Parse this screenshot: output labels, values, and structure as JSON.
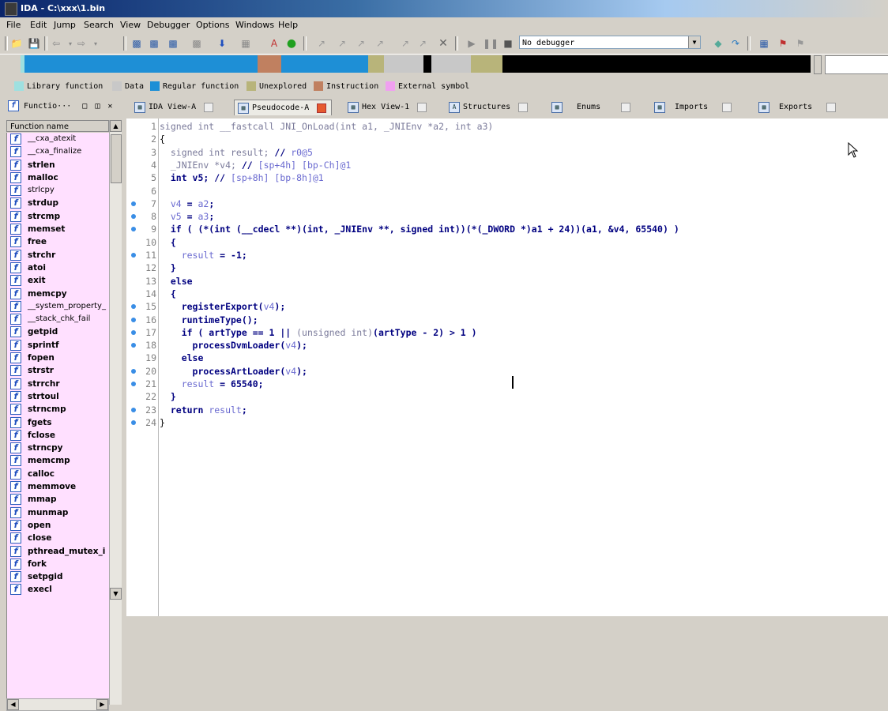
{
  "window": {
    "title": "IDA - C:\\xxx\\1.bin"
  },
  "menu": [
    "File",
    "Edit",
    "Jump",
    "Search",
    "View",
    "Debugger",
    "Options",
    "Windows",
    "Help"
  ],
  "toolbar": {
    "debugger_select": "No debugger"
  },
  "legend": [
    {
      "label": "Library function",
      "color": "#9ee0e0"
    },
    {
      "label": "Data",
      "color": "#c8c8c8"
    },
    {
      "label": "Regular function",
      "color": "#1e8fd6"
    },
    {
      "label": "Unexplored",
      "color": "#b8b47a"
    },
    {
      "label": "Instruction",
      "color": "#c08060"
    },
    {
      "label": "External symbol",
      "color": "#f0a0f0"
    }
  ],
  "functions_pane": {
    "tab_label": "Functio···",
    "header": "Function name",
    "items": [
      {
        "name": "__cxa_atexit",
        "bold": false
      },
      {
        "name": "__cxa_finalize",
        "bold": false
      },
      {
        "name": "strlen",
        "bold": true
      },
      {
        "name": "malloc",
        "bold": true
      },
      {
        "name": "strlcpy",
        "bold": false
      },
      {
        "name": "strdup",
        "bold": true
      },
      {
        "name": "strcmp",
        "bold": true
      },
      {
        "name": "memset",
        "bold": true
      },
      {
        "name": "free",
        "bold": true
      },
      {
        "name": "strchr",
        "bold": true
      },
      {
        "name": "atoi",
        "bold": true
      },
      {
        "name": "exit",
        "bold": true
      },
      {
        "name": "memcpy",
        "bold": true
      },
      {
        "name": "__system_property_",
        "bold": false
      },
      {
        "name": "__stack_chk_fail",
        "bold": false
      },
      {
        "name": "getpid",
        "bold": true
      },
      {
        "name": "sprintf",
        "bold": true
      },
      {
        "name": "fopen",
        "bold": true
      },
      {
        "name": "strstr",
        "bold": true
      },
      {
        "name": "strrchr",
        "bold": true
      },
      {
        "name": "strtoul",
        "bold": true
      },
      {
        "name": "strncmp",
        "bold": true
      },
      {
        "name": "fgets",
        "bold": true
      },
      {
        "name": "fclose",
        "bold": true
      },
      {
        "name": "strncpy",
        "bold": true
      },
      {
        "name": "memcmp",
        "bold": true
      },
      {
        "name": "calloc",
        "bold": true
      },
      {
        "name": "memmove",
        "bold": true
      },
      {
        "name": "mmap",
        "bold": true
      },
      {
        "name": "munmap",
        "bold": true
      },
      {
        "name": "open",
        "bold": true
      },
      {
        "name": "close",
        "bold": true
      },
      {
        "name": "pthread_mutex_i",
        "bold": true
      },
      {
        "name": "fork",
        "bold": true
      },
      {
        "name": "setpgid",
        "bold": true
      },
      {
        "name": "execl",
        "bold": true
      }
    ]
  },
  "tabs": [
    {
      "label": "IDA View-A",
      "active": false
    },
    {
      "label": "Pseudocode-A",
      "active": true
    },
    {
      "label": "Hex View-1",
      "active": false
    },
    {
      "label": "Structures",
      "active": false
    },
    {
      "label": "Enums",
      "active": false
    },
    {
      "label": "Imports",
      "active": false
    },
    {
      "label": "Exports",
      "active": false
    }
  ],
  "code": [
    {
      "n": "1",
      "bp": false,
      "segs": [
        [
          "c-gray",
          "signed int __fastcall JNI_OnLoad(int a1, _JNIEnv *a2, int a3)"
        ]
      ]
    },
    {
      "n": "2",
      "bp": false,
      "segs": [
        [
          "",
          "{"
        ]
      ]
    },
    {
      "n": "3",
      "bp": false,
      "segs": [
        [
          "c-gray",
          "  signed int result; "
        ],
        [
          "c-kw",
          "// "
        ],
        [
          "c-cmt",
          "r0@5"
        ]
      ]
    },
    {
      "n": "4",
      "bp": false,
      "segs": [
        [
          "c-gray",
          "  _JNIEnv *v4; "
        ],
        [
          "c-kw",
          "// "
        ],
        [
          "c-cmt",
          "[sp+4h] [bp-Ch]@1"
        ]
      ]
    },
    {
      "n": "5",
      "bp": false,
      "segs": [
        [
          "c-kw",
          "  int v5; // "
        ],
        [
          "c-cmt",
          "[sp+8h] [bp-8h]@1"
        ]
      ]
    },
    {
      "n": "6",
      "bp": false,
      "segs": [
        [
          "",
          ""
        ]
      ]
    },
    {
      "n": "7",
      "bp": true,
      "segs": [
        [
          "c-cmt",
          "  v4"
        ],
        [
          "c-kw",
          " = "
        ],
        [
          "c-cmt",
          "a2"
        ],
        [
          "c-kw",
          ";"
        ]
      ]
    },
    {
      "n": "8",
      "bp": true,
      "segs": [
        [
          "c-cmt",
          "  v5"
        ],
        [
          "c-kw",
          " = "
        ],
        [
          "c-cmt",
          "a3"
        ],
        [
          "c-kw",
          ";"
        ]
      ]
    },
    {
      "n": "9",
      "bp": true,
      "segs": [
        [
          "c-kw",
          "  if ( (*(int (__cdecl **)(int, _JNIEnv **, signed int))(*(_DWORD *)a1 + 24))(a1, &v4, 65540) )"
        ]
      ]
    },
    {
      "n": "10",
      "bp": false,
      "segs": [
        [
          "c-kw",
          "  {"
        ]
      ]
    },
    {
      "n": "11",
      "bp": true,
      "segs": [
        [
          "c-cmt",
          "    result"
        ],
        [
          "c-kw",
          " = -1;"
        ]
      ]
    },
    {
      "n": "12",
      "bp": false,
      "segs": [
        [
          "c-kw",
          "  }"
        ]
      ]
    },
    {
      "n": "13",
      "bp": false,
      "segs": [
        [
          "c-kw",
          "  else"
        ]
      ]
    },
    {
      "n": "14",
      "bp": false,
      "segs": [
        [
          "c-kw",
          "  {"
        ]
      ]
    },
    {
      "n": "15",
      "bp": true,
      "segs": [
        [
          "c-fn",
          "    registerExport("
        ],
        [
          "c-cmt",
          "v4"
        ],
        [
          "c-kw",
          ");"
        ]
      ]
    },
    {
      "n": "16",
      "bp": true,
      "segs": [
        [
          "c-fn",
          "    runtimeType();"
        ]
      ]
    },
    {
      "n": "17",
      "bp": true,
      "segs": [
        [
          "c-kw",
          "    if ( artType == 1 || "
        ],
        [
          "c-gray",
          "(unsigned int)"
        ],
        [
          "c-kw",
          "(artType - 2) > 1 )"
        ]
      ]
    },
    {
      "n": "18",
      "bp": true,
      "segs": [
        [
          "c-fn",
          "      processDvmLoader("
        ],
        [
          "c-cmt",
          "v4"
        ],
        [
          "c-kw",
          ");"
        ]
      ]
    },
    {
      "n": "19",
      "bp": false,
      "segs": [
        [
          "c-kw",
          "    else"
        ]
      ]
    },
    {
      "n": "20",
      "bp": true,
      "segs": [
        [
          "c-fn",
          "      processArtLoader("
        ],
        [
          "c-cmt",
          "v4"
        ],
        [
          "c-kw",
          ");"
        ]
      ]
    },
    {
      "n": "21",
      "bp": true,
      "segs": [
        [
          "c-cmt",
          "    result"
        ],
        [
          "c-kw",
          " = 65540;"
        ]
      ]
    },
    {
      "n": "22",
      "bp": false,
      "segs": [
        [
          "c-kw",
          "  }"
        ]
      ]
    },
    {
      "n": "23",
      "bp": true,
      "segs": [
        [
          "c-kw",
          "  return "
        ],
        [
          "c-cmt",
          "result"
        ],
        [
          "c-kw",
          ";"
        ]
      ]
    },
    {
      "n": "24",
      "bp": true,
      "segs": [
        [
          "",
          "}"
        ]
      ]
    }
  ]
}
